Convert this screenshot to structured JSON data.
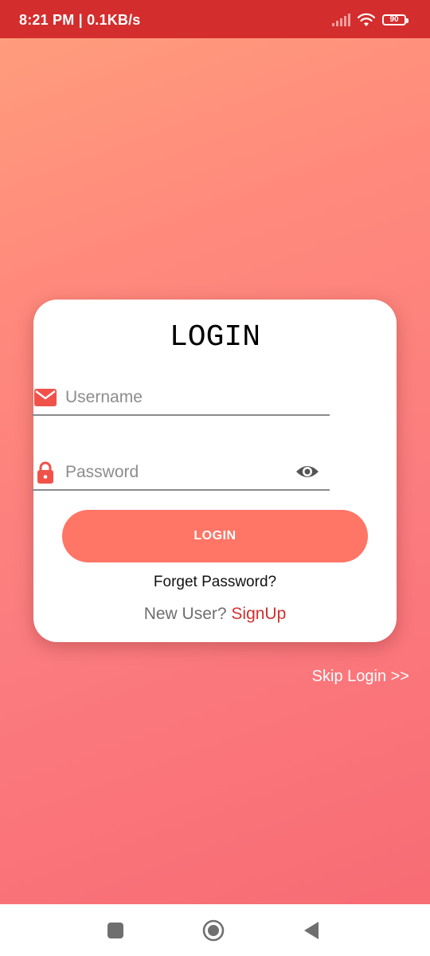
{
  "status_bar": {
    "time_speed": "8:21 PM | 0.1KB/s",
    "battery_level": "90",
    "icons": [
      "signal-icon",
      "wifi-icon",
      "battery-icon"
    ],
    "background": "#d42d2d"
  },
  "login_card": {
    "title": "LOGIN",
    "username": {
      "placeholder": "Username",
      "value": "",
      "icon": "mail-icon"
    },
    "password": {
      "placeholder": "Password",
      "value": "",
      "icon": "lock-icon",
      "toggle_icon": "eye-icon"
    },
    "login_button_label": "LOGIN",
    "forgot_password_label": "Forget Password?",
    "new_user_label": "New User?",
    "signup_label": "SignUp"
  },
  "skip_login_label": "Skip Login >>",
  "navigation_bar": {
    "items": [
      "recents-button",
      "home-button",
      "back-button"
    ]
  },
  "colors": {
    "accent": "#ff7566",
    "icon": "#f0524a",
    "signup": "#d32f2f",
    "gradient_top": "#ff9c7c",
    "gradient_bottom": "#f86c74"
  }
}
